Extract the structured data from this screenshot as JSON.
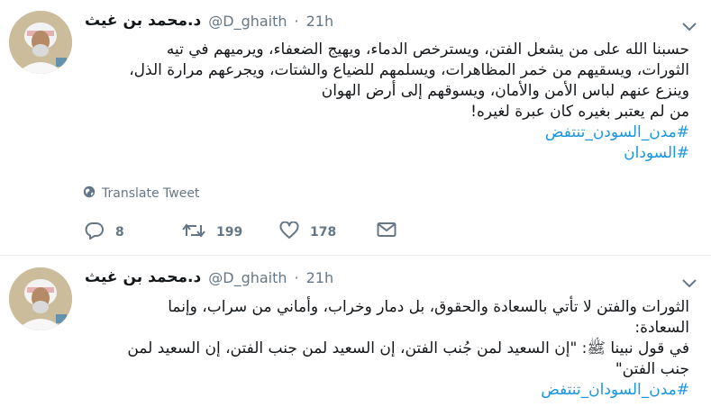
{
  "tweets": [
    {
      "author_name": "د.محمد بن غيث",
      "handle": "@D_ghaith",
      "separator": "·",
      "time": "21h",
      "lines": [
        "حسبنا الله على من يشعل الفتن، ويسترخص الدماء، ويهيج الضعفاء، ويرميهم في تيه",
        "الثورات، ويسقيهم من خمر المظاهرات، ويسلمهم للضياع والشتات، ويجرعهم مرارة الذل،",
        "وينزع عنهم لباس الأمن والأمان، ويسوقهم إلى أرض الهوان",
        "من لم يعتبر بغيره كان عبرة لغيره!"
      ],
      "hashtags": [
        "#مدن_السودن_تنتفض",
        "#السودان"
      ],
      "translate_label": "Translate Tweet",
      "replies": "8",
      "retweets": "199",
      "likes": "178"
    },
    {
      "author_name": "د.محمد بن غيث",
      "handle": "@D_ghaith",
      "separator": "·",
      "time": "21h",
      "lines": [
        "الثورات والفتن لا تأتي بالسعادة والحقوق، بل دمار وخراب، وأماني من سراب، وإنما",
        "السعادة:",
        "في قول نبينا ﷺ: \"إن السعيد لمن جُنب الفتن، إن السعيد لمن جنب الفتن، إن السعيد لمن",
        "جنب الفتن\""
      ],
      "hashtags": [
        "#مدن_السودان_تنتفض"
      ]
    }
  ],
  "icons": {
    "reply": "reply-icon",
    "retweet": "retweet-icon",
    "like": "heart-icon",
    "dm": "envelope-icon",
    "translate": "globe-icon",
    "menu": "chevron-down-icon"
  },
  "colors": {
    "link": "#1b95e0",
    "muted": "#657786",
    "text": "#14171a",
    "divider": "#e6ecf0"
  }
}
